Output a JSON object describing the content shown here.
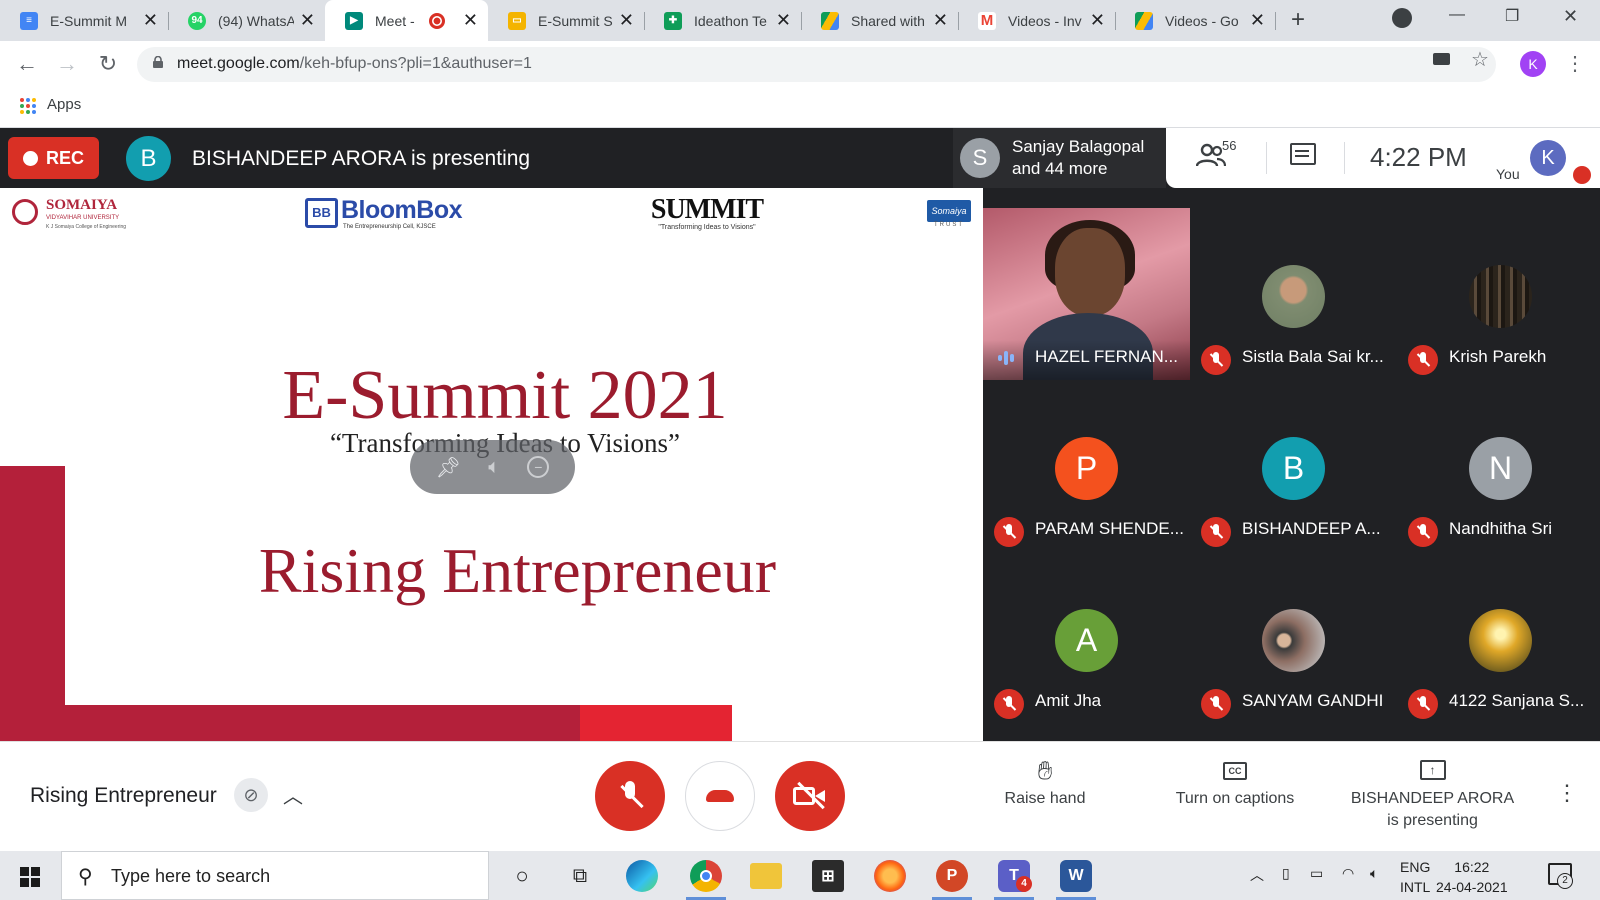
{
  "browser": {
    "tabs": [
      {
        "title": "E-Summit M",
        "favicon": "docs-icon",
        "color": "#4285f4"
      },
      {
        "title": "(94) WhatsA",
        "favicon": "whatsapp-icon",
        "color": "#25d366",
        "badge": "94"
      },
      {
        "title": "Meet -",
        "favicon": "meet-icon",
        "color": "#00897b",
        "active": true,
        "recording": true
      },
      {
        "title": "E-Summit S",
        "favicon": "slides-icon",
        "color": "#f4b400"
      },
      {
        "title": "Ideathon Te",
        "favicon": "sheets-icon",
        "color": "#0f9d58"
      },
      {
        "title": "Shared with",
        "favicon": "drive-icon",
        "color": "#fbbc04"
      },
      {
        "title": "Videos - Inv",
        "favicon": "gmail-icon",
        "color": "#ea4335"
      },
      {
        "title": "Videos - Go",
        "favicon": "drive-icon",
        "color": "#fbbc04"
      }
    ],
    "url_host": "meet.google.com",
    "url_path": "/keh-bfup-ons?pli=1&authuser=1",
    "profile_initial": "K",
    "bookmarks_apps": "Apps"
  },
  "meet": {
    "rec_label": "REC",
    "presenter_initial": "B",
    "presenting_text": "BISHANDEEP ARORA is presenting",
    "speaker_initial": "S",
    "speaker_line1": "Sanjay Balagopal",
    "speaker_line2": "and 44 more",
    "participant_count": "56",
    "time": "4:22  PM",
    "you_label": "You",
    "you_initial": "K"
  },
  "slide": {
    "logo_somaiya": "SOMAIYA",
    "logo_somaiya_sub": "VIDYAVIHAR UNIVERSITY",
    "logo_somaiya_college": "K J Somaiya College of Engineering",
    "logo_bloombox": "BloomBox",
    "logo_bloombox_tag": "The Entrepreneurship Cell, KJSCE",
    "logo_summit": "SUMMIT",
    "logo_summit_tag": "\"Transforming Ideas to Visions\"",
    "logo_trust": "Somaiya",
    "logo_trust_sub": "TRUST",
    "title": "E-Summit 2021",
    "tagline": "“Transforming Ideas to Visions”",
    "award": "Rising Entrepreneur"
  },
  "participants": [
    {
      "name": "HAZEL FERNAN...",
      "video": true,
      "speaking": true
    },
    {
      "name": "Sistla Bala Sai kr...",
      "photo": "portrait-photo",
      "muted": true,
      "avatar_color": "#7f8c70"
    },
    {
      "name": "Krish Parekh",
      "photo": "forest-photo",
      "muted": true,
      "avatar_color": "#3a3328"
    },
    {
      "name": "PARAM SHENDE...",
      "initial": "P",
      "muted": true,
      "avatar_color": "#f4511e"
    },
    {
      "name": "BISHANDEEP A...",
      "initial": "B",
      "muted": true,
      "avatar_color": "#129eaf"
    },
    {
      "name": "Nandhitha Sri",
      "initial": "N",
      "muted": true,
      "avatar_color": "#9aa0a6"
    },
    {
      "name": "Amit Jha",
      "initial": "A",
      "muted": true,
      "avatar_color": "#689f38"
    },
    {
      "name": "SANYAM GANDHI",
      "photo": "group-photo",
      "muted": true,
      "avatar_color": "#8d6e63"
    },
    {
      "name": "4122 Sanjana S...",
      "photo": "tree-sunset-photo",
      "muted": true,
      "avatar_color": "#c9a227"
    }
  ],
  "controls": {
    "meeting_name": "Rising Entrepreneur",
    "raise_hand": "Raise hand",
    "captions": "Turn on captions",
    "captions_icon_text": "CC",
    "presenting_line1": "BISHANDEEP ARORA",
    "presenting_line2": "is presenting"
  },
  "taskbar": {
    "search_placeholder": "Type here to search",
    "lang_top": "ENG",
    "lang_bottom": "INTL",
    "time": "16:22",
    "date": "24-04-2021",
    "notification_count": "2",
    "teams_badge": "4"
  }
}
